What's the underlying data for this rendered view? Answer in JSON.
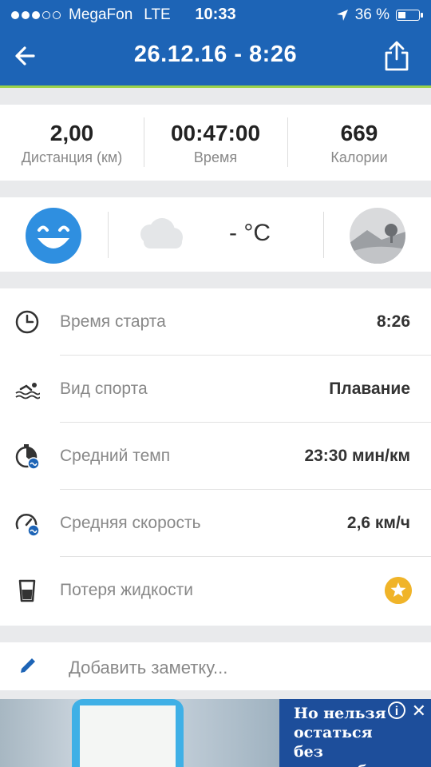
{
  "status_bar": {
    "carrier": "MegaFon",
    "network": "LTE",
    "time": "10:33",
    "battery": "36 %"
  },
  "nav": {
    "title": "26.12.16 - 8:26",
    "back_icon": "arrow-left-icon",
    "share_icon": "share-icon"
  },
  "stats": [
    {
      "value": "2,00",
      "label": "Дистанция (км)"
    },
    {
      "value": "00:47:00",
      "label": "Время"
    },
    {
      "value": "669",
      "label": "Калории"
    }
  ],
  "weather": {
    "mood_icon": "happy-face-icon",
    "weather_icon": "cloud-icon",
    "temperature": "- °C",
    "terrain_icon": "landscape-icon"
  },
  "details": [
    {
      "icon": "clock-icon",
      "label": "Время старта",
      "value": "8:26"
    },
    {
      "icon": "swimming-icon",
      "label": "Вид спорта",
      "value": "Плавание"
    },
    {
      "icon": "pace-stopwatch-icon",
      "label": "Средний темп",
      "value": "23:30 мин/км"
    },
    {
      "icon": "speedometer-icon",
      "label": "Средняя скорость",
      "value": "2,6 км/ч"
    },
    {
      "icon": "water-glass-icon",
      "label": "Потеря жидкости",
      "value": ""
    }
  ],
  "note": {
    "icon": "pencil-icon",
    "placeholder": "Добавить заметку..."
  },
  "ad": {
    "text": "Но нельзя остаться без автомобиля",
    "info": "i",
    "close": "✕"
  },
  "colors": {
    "header": "#1d64b6",
    "accent_line": "#9bd34a",
    "star": "#f0b429",
    "smiley": "#2f8fe0"
  }
}
